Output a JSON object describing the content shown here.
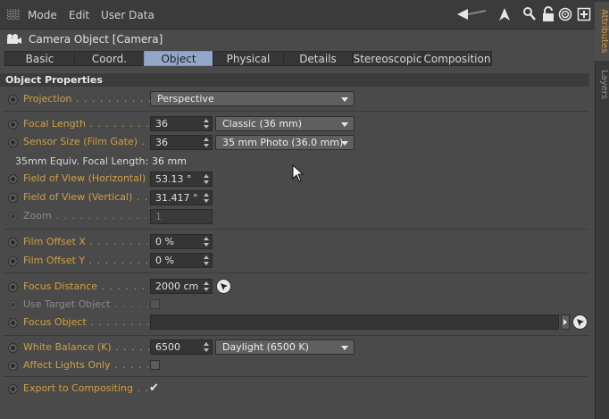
{
  "menu": {
    "mode": "Mode",
    "edit": "Edit",
    "user_data": "User Data"
  },
  "header": {
    "title": "Camera Object [Camera]"
  },
  "tabs": [
    "Basic",
    "Coord.",
    "Object",
    "Physical",
    "Details",
    "Stereoscopic",
    "Composition"
  ],
  "active_tab": "Object",
  "section": {
    "title": "Object Properties"
  },
  "params": {
    "projection": {
      "label": "Projection",
      "value": "Perspective"
    },
    "focal_length": {
      "label": "Focal Length",
      "value": "36",
      "preset": "Classic (36 mm)"
    },
    "sensor_size": {
      "label": "Sensor Size (Film Gate)",
      "value": "36",
      "preset": "35 mm Photo (36.0 mm)"
    },
    "equiv_focal": {
      "label": "35mm Equiv. Focal Length:",
      "value": "36 mm"
    },
    "fov_h": {
      "label": "Field of View (Horizontal)",
      "value": "53.13 °"
    },
    "fov_v": {
      "label": "Field of View (Vertical)",
      "value": "31.417 °"
    },
    "zoom": {
      "label": "Zoom",
      "value": "1"
    },
    "film_offset_x": {
      "label": "Film Offset X",
      "value": "0 %"
    },
    "film_offset_y": {
      "label": "Film Offset Y",
      "value": "0 %"
    },
    "focus_distance": {
      "label": "Focus Distance",
      "value": "2000 cm"
    },
    "use_target": {
      "label": "Use Target Object",
      "checked": false
    },
    "focus_object": {
      "label": "Focus Object",
      "value": ""
    },
    "white_balance": {
      "label": "White Balance (K)",
      "value": "6500",
      "preset": "Daylight (6500 K)"
    },
    "affect_lights": {
      "label": "Affect Lights Only",
      "checked": false
    },
    "export_comp": {
      "label": "Export to Compositing",
      "checked": true
    }
  },
  "side_tabs": [
    "Attributes",
    "Layers"
  ],
  "active_side_tab": "Attributes",
  "colors": {
    "label": "#d0a03c",
    "active_tab": "#92a7c9",
    "side_active": "#e0962a"
  },
  "icons": [
    "grid-menu-icon",
    "back-arrow-icon",
    "cursor-up-icon",
    "search-icon",
    "lock-icon",
    "target-icon",
    "add-panel-icon",
    "camera-icon",
    "picker-icon",
    "mouse-cursor-icon"
  ]
}
